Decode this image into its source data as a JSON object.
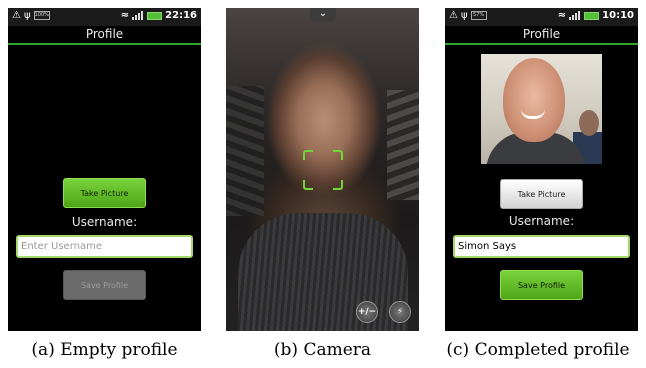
{
  "panel_a": {
    "status": {
      "left_icons": [
        "warning-icon",
        "usb-icon"
      ],
      "battery_label": "100%",
      "time": "22:16"
    },
    "title": "Profile",
    "take_picture_label": "Take Picture",
    "username_label": "Username:",
    "username_value": "",
    "username_placeholder": "Enter Username",
    "save_label": "Save Profile",
    "save_enabled": false,
    "caption": "(a) Empty profile"
  },
  "panel_b": {
    "chevron": "⌄",
    "exposure_label": "+/−",
    "flash_label": "⚡",
    "caption": "(b) Camera"
  },
  "panel_c": {
    "status": {
      "left_icons": [
        "warning-icon",
        "usb-icon"
      ],
      "battery_label": "57%",
      "time": "10:10"
    },
    "title": "Profile",
    "take_picture_label": "Take Picture",
    "username_label": "Username:",
    "username_value": "Simon Says",
    "save_label": "Save Profile",
    "save_enabled": true,
    "caption": "(c) Completed profile"
  },
  "colors": {
    "accent_green": "#2fa62b",
    "button_green": "#4fa517",
    "field_border": "#a6d76a",
    "focus_green": "#72d63a"
  }
}
